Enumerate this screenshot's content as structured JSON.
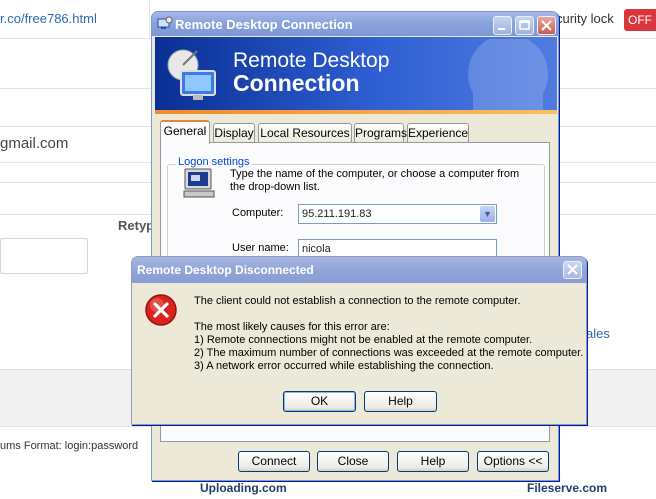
{
  "background": {
    "url_text": "r.co/free786.html",
    "security_lock": "curity lock",
    "security_toggle": "OFF",
    "email_text": "gmail.com",
    "retype_label": "Retyp",
    "ales_text": "ales",
    "format_prefix": "ums",
    "format_text": "Format: login:password",
    "footer_left": "Uploading.com",
    "footer_right": "Fileserve.com"
  },
  "rdc_window": {
    "title": "Remote Desktop Connection",
    "banner_line1": "Remote Desktop",
    "banner_line2": "Connection",
    "tabs": [
      "General",
      "Display",
      "Local Resources",
      "Programs",
      "Experience"
    ],
    "group_label": "Logon settings",
    "info_text": "Type the name of the computer, or choose a computer from the drop-down list.",
    "computer_label": "Computer:",
    "computer_value": "95.211.191.83",
    "username_label": "User name:",
    "username_value": "nicola",
    "buttons": {
      "connect": "Connect",
      "close": "Close",
      "help": "Help",
      "options": "Options <<"
    }
  },
  "error_dialog": {
    "title": "Remote Desktop Disconnected",
    "message": "The client could not establish a connection to the remote computer.",
    "causes_heading": "The most likely causes for this error are:",
    "causes": [
      "1) Remote connections might not be enabled at the remote computer.",
      "2) The maximum number of connections was exceeded at the remote computer.",
      "3) A network error occurred while establishing the connection."
    ],
    "ok_label": "OK",
    "help_label": "Help"
  }
}
